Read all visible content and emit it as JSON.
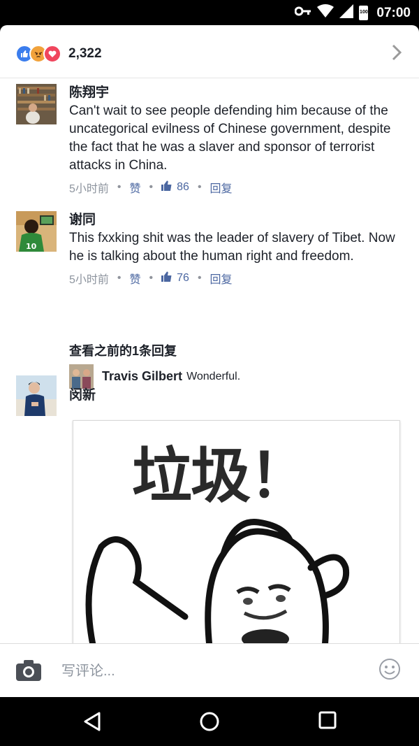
{
  "status_bar": {
    "time": "07:00",
    "battery": "100"
  },
  "reactions": {
    "count": "2,322",
    "icons": [
      "like-icon",
      "angry-icon",
      "love-icon"
    ]
  },
  "comments": [
    {
      "name": "陈翔宇",
      "text": "Can't wait to see people defending him because of the uncategorical evilness of Chinese government, despite the fact that he was a slaver and sponsor of terrorist attacks in China.",
      "time": "5小时前",
      "like_label": "赞",
      "likes": "86",
      "reply_label": "回复"
    },
    {
      "name": "谢同",
      "text": "This fxxking shit was the leader of slavery of Tibet. Now he is talking about the human right and freedom.",
      "time": "5小时前",
      "like_label": "赞",
      "likes": "76",
      "reply_label": "回复"
    },
    {
      "name": "闵新",
      "sticker_caption": "垃圾！"
    }
  ],
  "view_previous_replies": "查看之前的1条回复",
  "reply": {
    "name": "Travis Gilbert",
    "text": "Wonderful."
  },
  "composer": {
    "placeholder": "写评论..."
  },
  "colors": {
    "accent": "#4b67a1",
    "text": "#1d2129",
    "muted": "#8d949e"
  }
}
